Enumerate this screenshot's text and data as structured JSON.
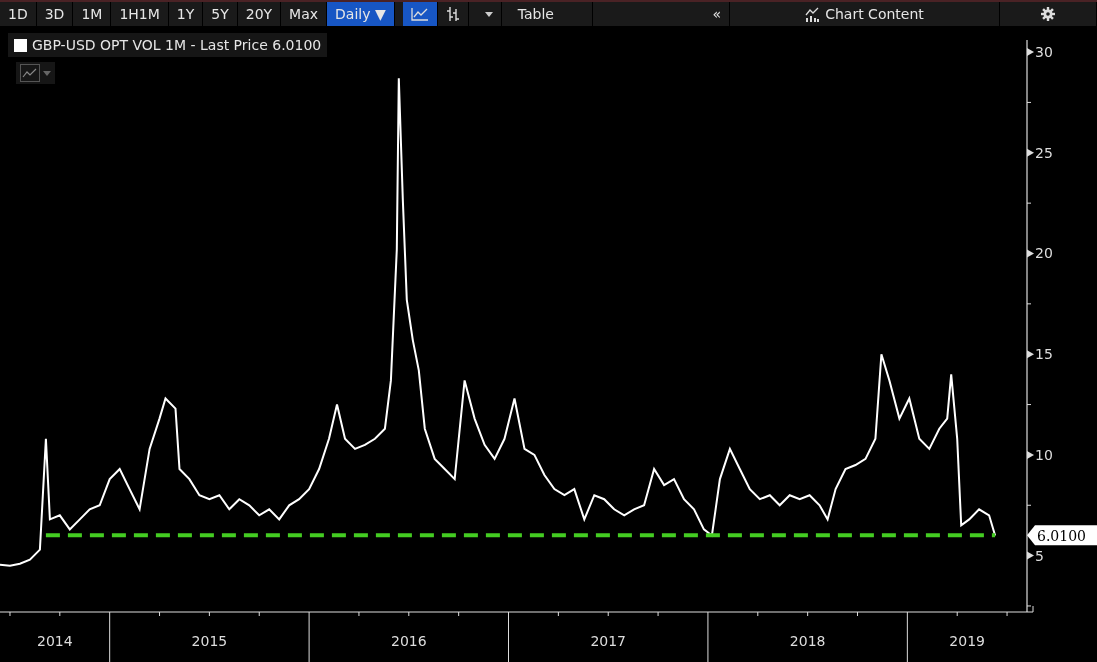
{
  "toolbar": {
    "ranges": [
      {
        "label": "1D",
        "selected": false
      },
      {
        "label": "3D",
        "selected": false
      },
      {
        "label": "1M",
        "selected": false
      },
      {
        "label": "1H1M",
        "selected": false
      },
      {
        "label": "1Y",
        "selected": false
      },
      {
        "label": "5Y",
        "selected": false
      },
      {
        "label": "20Y",
        "selected": false
      },
      {
        "label": "Max",
        "selected": false
      }
    ],
    "frequency": {
      "label": "Daily ▼",
      "selected": true
    },
    "chart_types": [
      {
        "kind": "line",
        "selected": true
      },
      {
        "kind": "bars",
        "selected": false
      }
    ],
    "table_button": "Table",
    "collapse_button": "«",
    "chart_content_button": "Chart Content"
  },
  "chart": {
    "partial_year_labels": [
      "2014",
      "2019"
    ],
    "chart_data": {
      "type": "line",
      "ylim": [
        2.2,
        30.6
      ],
      "xlim": [
        2013.95,
        2019.1
      ],
      "xticks": [
        2015,
        2016,
        2017,
        2018
      ],
      "yticks": [
        5,
        10,
        15,
        20,
        25,
        30
      ],
      "x": [
        2013.95,
        2014.0,
        2014.05,
        2014.1,
        2014.15,
        2014.18,
        2014.2,
        2014.25,
        2014.3,
        2014.35,
        2014.4,
        2014.45,
        2014.5,
        2014.55,
        2014.6,
        2014.65,
        2014.7,
        2014.75,
        2014.78,
        2014.83,
        2014.85,
        2014.9,
        2014.95,
        2015.0,
        2015.05,
        2015.1,
        2015.15,
        2015.2,
        2015.25,
        2015.3,
        2015.35,
        2015.4,
        2015.45,
        2015.5,
        2015.55,
        2015.6,
        2015.64,
        2015.68,
        2015.73,
        2015.78,
        2015.83,
        2015.88,
        2015.91,
        2015.94,
        2015.95,
        2015.97,
        2015.99,
        2016.02,
        2016.05,
        2016.08,
        2016.13,
        2016.18,
        2016.23,
        2016.28,
        2016.33,
        2016.38,
        2016.43,
        2016.48,
        2016.53,
        2016.58,
        2016.63,
        2016.68,
        2016.73,
        2016.78,
        2016.83,
        2016.88,
        2016.93,
        2016.98,
        2017.03,
        2017.08,
        2017.13,
        2017.18,
        2017.23,
        2017.28,
        2017.33,
        2017.38,
        2017.43,
        2017.48,
        2017.52,
        2017.56,
        2017.61,
        2017.66,
        2017.71,
        2017.76,
        2017.81,
        2017.86,
        2017.91,
        2017.96,
        2018.01,
        2018.06,
        2018.1,
        2018.14,
        2018.19,
        2018.24,
        2018.29,
        2018.34,
        2018.37,
        2018.41,
        2018.46,
        2018.51,
        2018.56,
        2018.61,
        2018.66,
        2018.7,
        2018.72,
        2018.75,
        2018.77,
        2018.81,
        2018.86,
        2018.91,
        2018.94
      ],
      "series": [
        {
          "name": "GBP-USD OPT VOL 1M - Last Price 6.0100",
          "color": "#ffffff",
          "values": [
            4.55,
            4.5,
            4.6,
            4.8,
            5.3,
            10.8,
            6.8,
            7.0,
            6.3,
            6.8,
            7.3,
            7.5,
            8.8,
            9.3,
            8.3,
            7.3,
            10.3,
            11.8,
            12.8,
            12.3,
            9.3,
            8.8,
            8.0,
            7.8,
            8.0,
            7.3,
            7.8,
            7.5,
            7.0,
            7.3,
            6.8,
            7.5,
            7.8,
            8.3,
            9.3,
            10.8,
            12.5,
            10.8,
            10.3,
            10.5,
            10.8,
            11.3,
            13.7,
            20.2,
            28.7,
            22.7,
            17.7,
            15.7,
            14.2,
            11.3,
            9.8,
            9.3,
            8.8,
            13.7,
            11.8,
            10.5,
            9.8,
            10.8,
            12.8,
            10.3,
            10.0,
            9.0,
            8.3,
            8.0,
            8.3,
            6.8,
            8.0,
            7.8,
            7.3,
            7.0,
            7.3,
            7.5,
            9.3,
            8.5,
            8.8,
            7.8,
            7.3,
            6.3,
            6.0,
            8.8,
            10.3,
            9.3,
            8.3,
            7.8,
            8.0,
            7.5,
            8.0,
            7.8,
            8.0,
            7.5,
            6.8,
            8.3,
            9.3,
            9.5,
            9.8,
            10.8,
            15.0,
            13.7,
            11.8,
            12.8,
            10.8,
            10.3,
            11.3,
            11.8,
            14.0,
            10.8,
            6.5,
            6.8,
            7.3,
            7.0,
            6.0
          ]
        },
        {
          "name": "6.0100",
          "color": "#44cc22",
          "line_style": "dashed",
          "values": [
            null,
            null,
            null,
            null,
            null,
            6.01,
            6.01,
            6.01,
            6.01,
            6.01,
            6.01,
            6.01,
            6.01,
            6.01,
            6.01,
            6.01,
            6.01,
            6.01,
            6.01,
            6.01,
            6.01,
            6.01,
            6.01,
            6.01,
            6.01,
            6.01,
            6.01,
            6.01,
            6.01,
            6.01,
            6.01,
            6.01,
            6.01,
            6.01,
            6.01,
            6.01,
            6.01,
            6.01,
            6.01,
            6.01,
            6.01,
            6.01,
            6.01,
            6.01,
            6.01,
            6.01,
            6.01,
            6.01,
            6.01,
            6.01,
            6.01,
            6.01,
            6.01,
            6.01,
            6.01,
            6.01,
            6.01,
            6.01,
            6.01,
            6.01,
            6.01,
            6.01,
            6.01,
            6.01,
            6.01,
            6.01,
            6.01,
            6.01,
            6.01,
            6.01,
            6.01,
            6.01,
            6.01,
            6.01,
            6.01,
            6.01,
            6.01,
            6.01,
            6.01,
            6.01,
            6.01,
            6.01,
            6.01,
            6.01,
            6.01,
            6.01,
            6.01,
            6.01,
            6.01,
            6.01,
            6.01,
            6.01,
            6.01,
            6.01,
            6.01,
            6.01,
            6.01,
            6.01,
            6.01,
            6.01,
            6.01,
            6.01,
            6.01,
            6.01,
            6.01,
            6.01,
            6.01,
            6.01,
            6.01,
            6.01,
            6.01
          ]
        }
      ]
    }
  }
}
